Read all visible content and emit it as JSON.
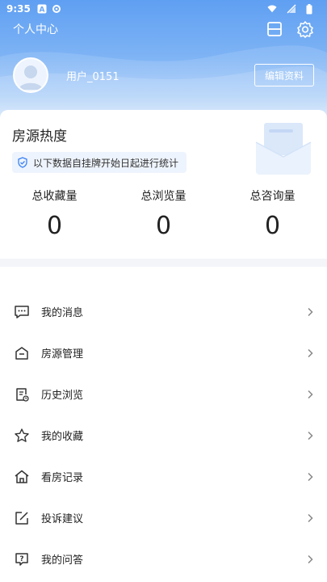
{
  "status_bar": {
    "time": "9:35",
    "icons": [
      "a-badge-icon",
      "gear-status-icon",
      "wifi-icon",
      "mute-icon",
      "battery-icon"
    ]
  },
  "header": {
    "title": "个人中心",
    "actions": [
      "scan-icon",
      "settings-icon"
    ],
    "gradient_colors": [
      "#5f9ff2",
      "#e6f0fd"
    ]
  },
  "profile": {
    "username": "用户_0151",
    "edit_label": "编辑资料"
  },
  "popularity": {
    "title": "房源热度",
    "notice": "以下数据自挂牌开始日起进行统计",
    "stats": [
      {
        "label": "总收藏量",
        "value": "0"
      },
      {
        "label": "总浏览量",
        "value": "0"
      },
      {
        "label": "总咨询量",
        "value": "0"
      }
    ]
  },
  "menu": {
    "items": [
      {
        "label": "我的消息",
        "icon": "message-icon"
      },
      {
        "label": "房源管理",
        "icon": "house-manage-icon"
      },
      {
        "label": "历史浏览",
        "icon": "history-icon"
      },
      {
        "label": "我的收藏",
        "icon": "star-icon"
      },
      {
        "label": "看房记录",
        "icon": "home-icon"
      },
      {
        "label": "投诉建议",
        "icon": "edit-icon"
      },
      {
        "label": "我的问答",
        "icon": "question-icon"
      }
    ]
  }
}
